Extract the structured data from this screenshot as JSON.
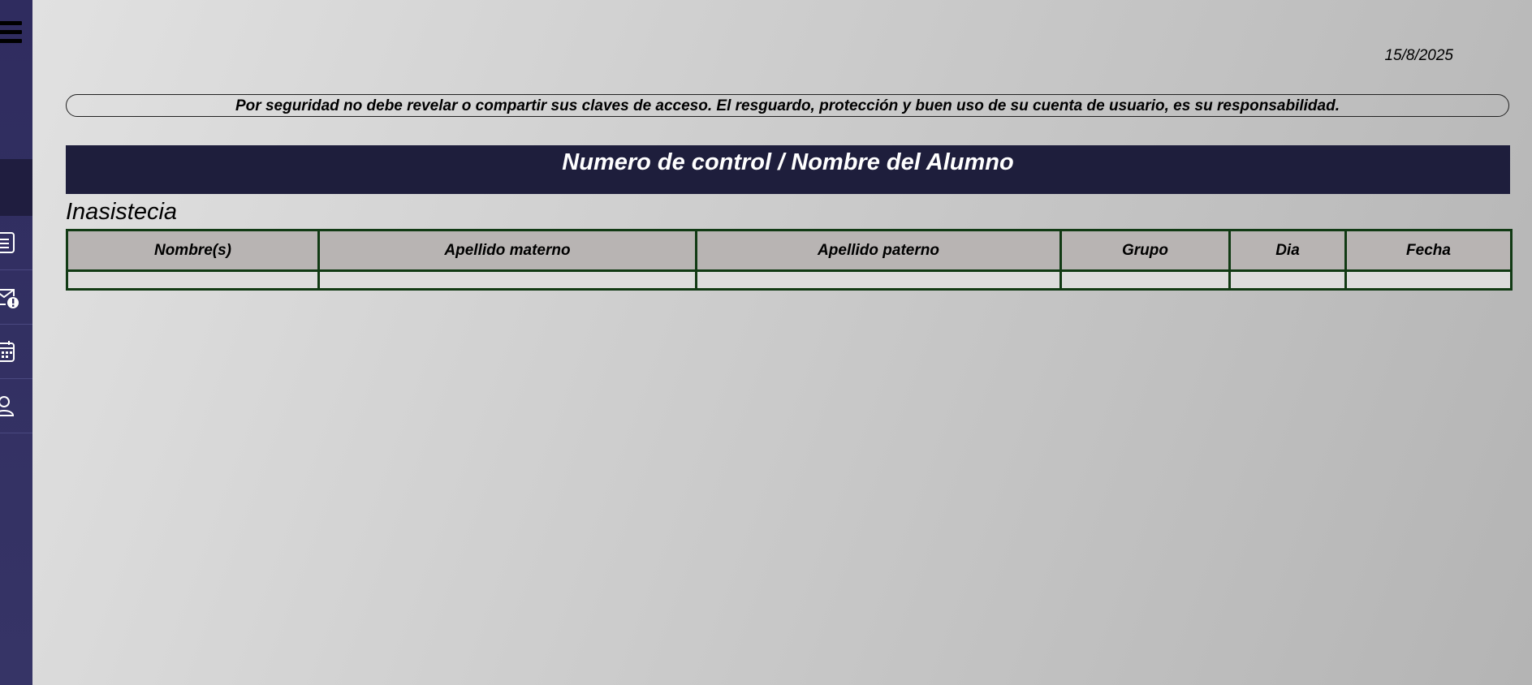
{
  "sidebar": {
    "menu_icon": "hamburger-menu-icon",
    "items": [
      {
        "icon": "document-list-icon",
        "name": "nav-item-list"
      },
      {
        "icon": "mail-alert-icon",
        "name": "nav-item-mail-alert"
      },
      {
        "icon": "calendar-icon",
        "name": "nav-item-calendar"
      },
      {
        "icon": "user-icon",
        "name": "nav-item-user"
      }
    ],
    "colors": {
      "background": "#2f2c5f",
      "active_band": "#1f1d3f"
    }
  },
  "header": {
    "date": "15/8/2025",
    "notice": "Por seguridad no debe revelar o compartir sus claves de acceso. El resguardo, protección y buen uso de su cuenta de usuario, es su responsabilidad."
  },
  "student_banner": {
    "title": "Numero de control / Nombre del Alumno",
    "color": "#1e1e3c"
  },
  "absences": {
    "title": "Inasistecia",
    "columns": [
      "Nombre(s)",
      "Apellido materno",
      "Apellido paterno",
      "Grupo",
      "Dia",
      "Fecha"
    ],
    "rows": [
      [
        "",
        "",
        "",
        "",
        "",
        ""
      ]
    ],
    "border_color": "#113a14",
    "header_color": "#b8b4b3"
  }
}
